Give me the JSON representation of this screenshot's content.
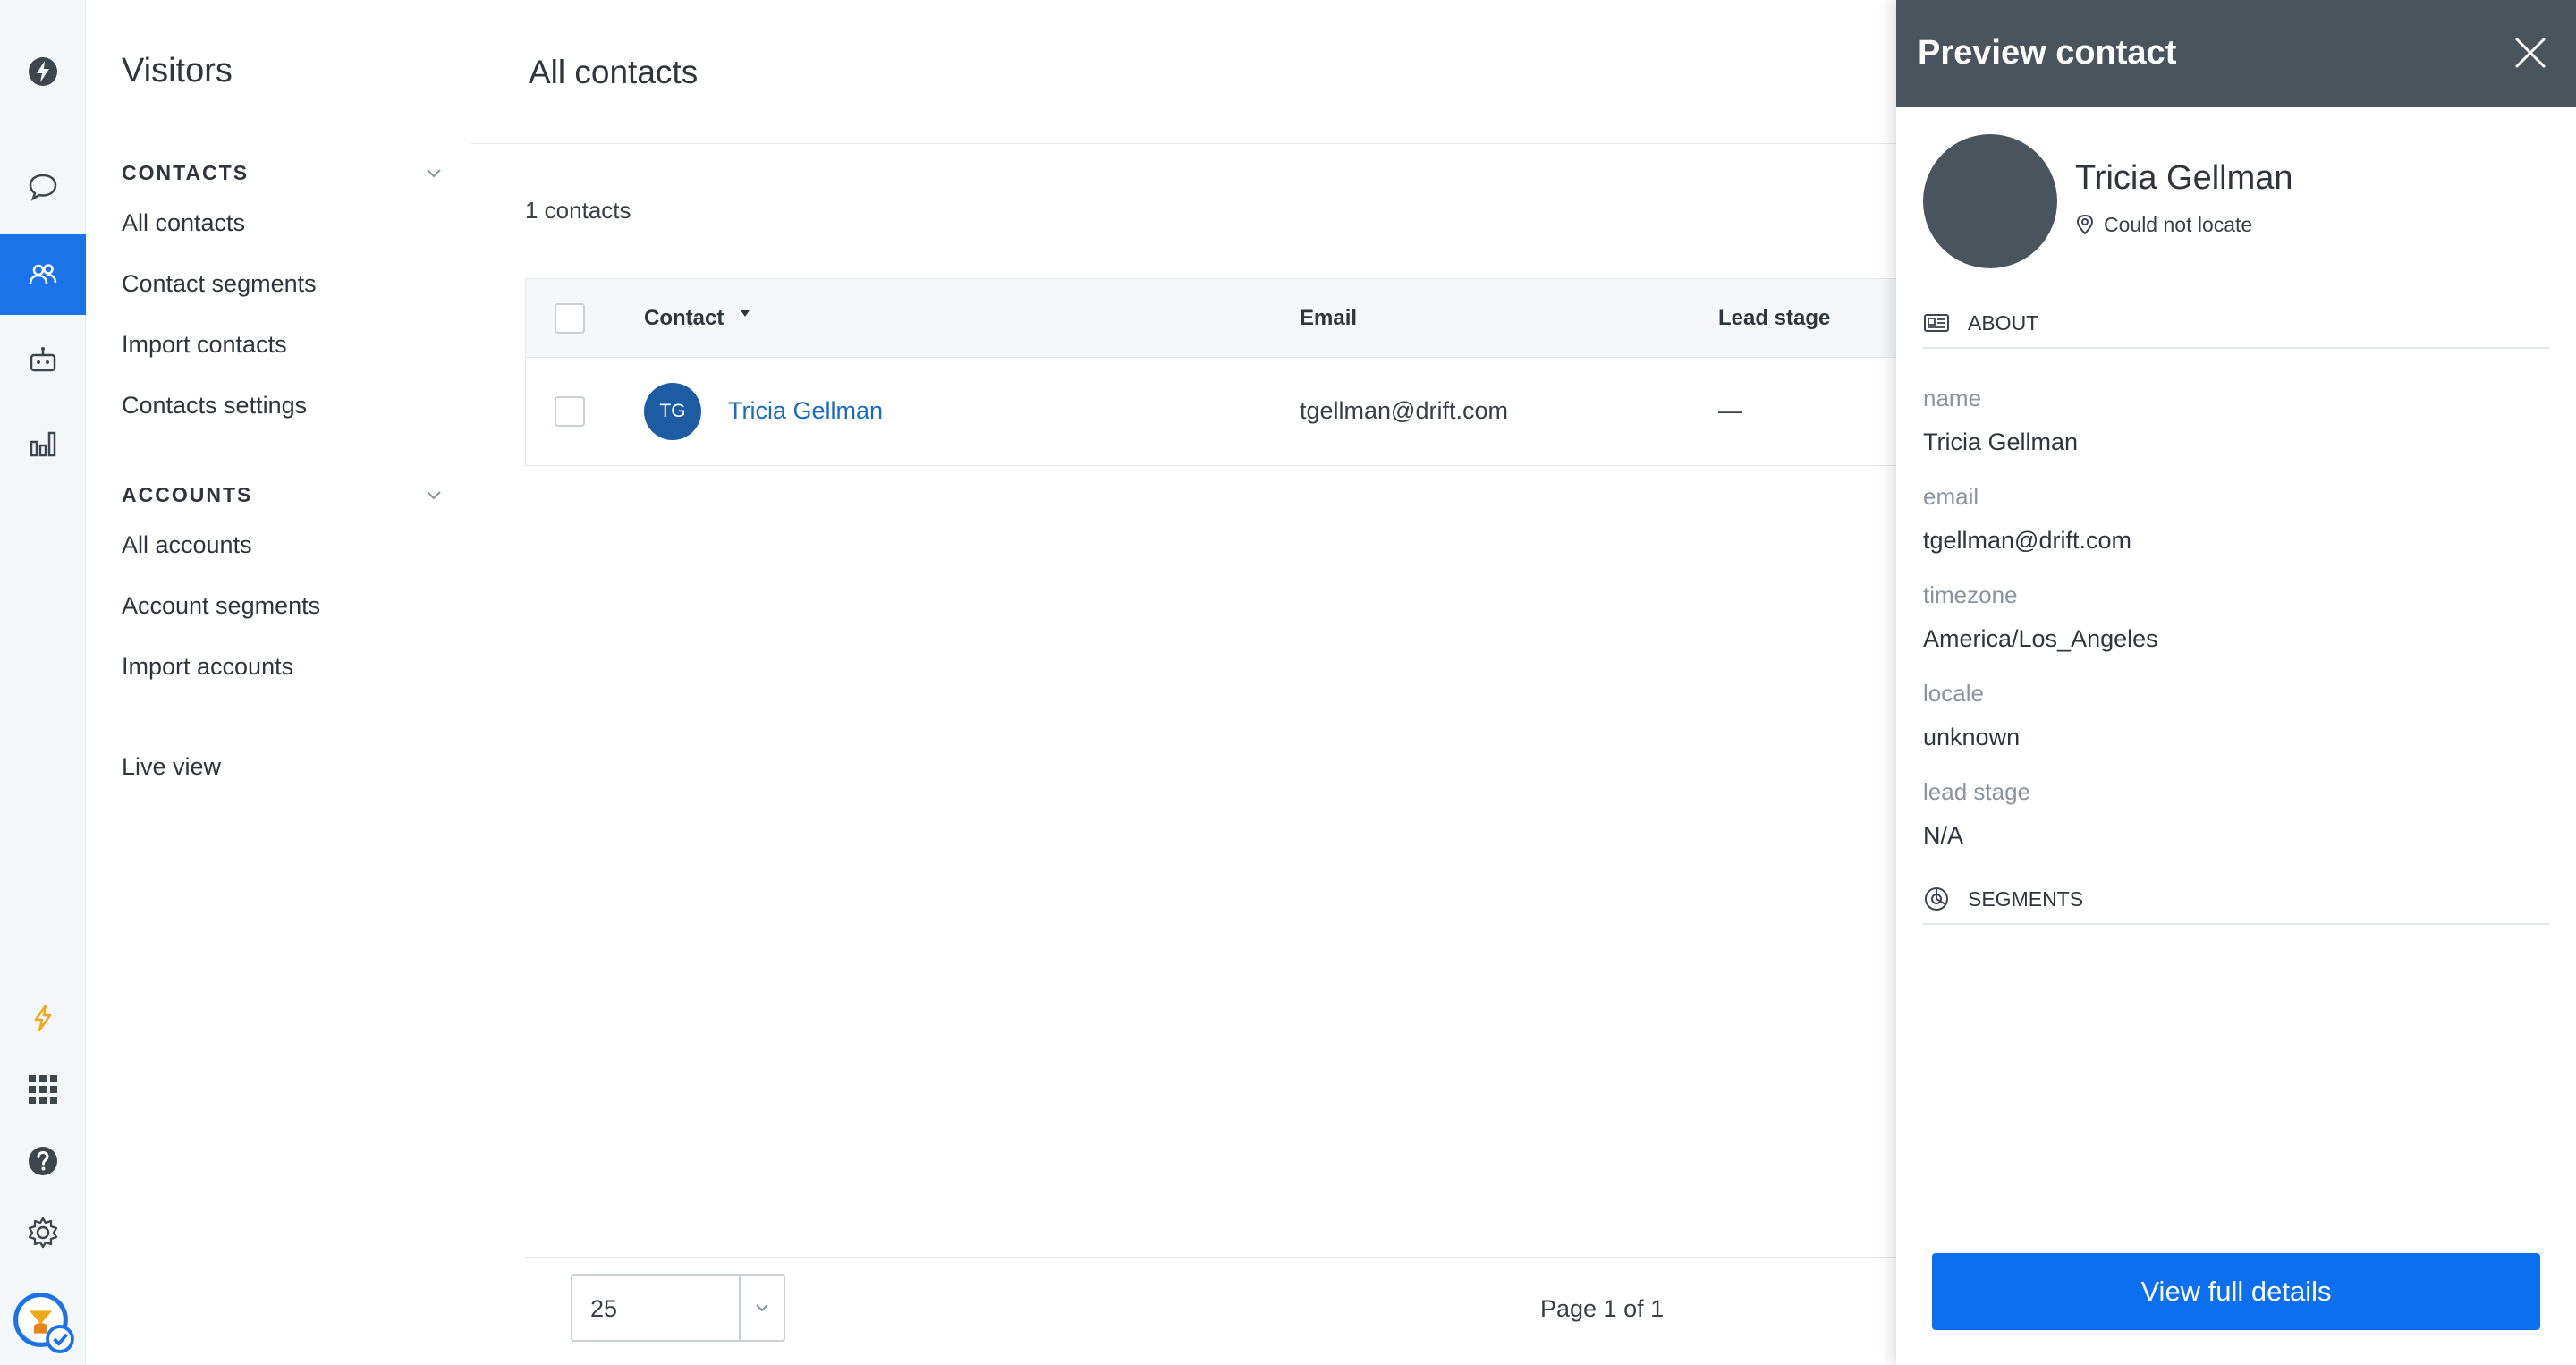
{
  "rail": {
    "items": [
      {
        "name": "drift-logo-icon"
      },
      {
        "name": "chat-icon"
      },
      {
        "name": "contacts-icon",
        "active": true
      },
      {
        "name": "bot-icon"
      },
      {
        "name": "reports-icon"
      },
      {
        "name": "lightning-icon"
      },
      {
        "name": "apps-grid-icon"
      },
      {
        "name": "help-icon"
      },
      {
        "name": "settings-icon"
      },
      {
        "name": "user-status-avatar-icon"
      }
    ],
    "accent": "#1a73e8"
  },
  "subnav": {
    "title": "Visitors",
    "contacts_heading": "CONTACTS",
    "contacts_items": [
      "All contacts",
      "Contact segments",
      "Import contacts",
      "Contacts settings"
    ],
    "accounts_heading": "ACCOUNTS",
    "accounts_items": [
      "All accounts",
      "Account segments",
      "Import accounts"
    ],
    "live_view": "Live view"
  },
  "main": {
    "title": "All contacts",
    "count_label": "1 contacts",
    "columns": [
      "Contact",
      "Email",
      "Lead stage"
    ],
    "rows": [
      {
        "initials": "TG",
        "name": "Tricia Gellman",
        "email": "tgellman@drift.com",
        "lead_stage": "—"
      }
    ],
    "per_page": "25",
    "page_indicator": "Page 1 of 1"
  },
  "panel": {
    "title": "Preview contact",
    "name": "Tricia Gellman",
    "location": "Could not locate",
    "about_heading": "ABOUT",
    "fields": [
      {
        "label": "name",
        "value": "Tricia Gellman"
      },
      {
        "label": "email",
        "value": "tgellman@drift.com"
      },
      {
        "label": "timezone",
        "value": "America/Los_Angeles"
      },
      {
        "label": "locale",
        "value": "unknown"
      },
      {
        "label": "lead stage",
        "value": "N/A"
      }
    ],
    "segments_heading": "SEGMENTS",
    "primary_button": "View full details",
    "header_color": "#4a545d",
    "button_color": "#0b6ff0"
  }
}
